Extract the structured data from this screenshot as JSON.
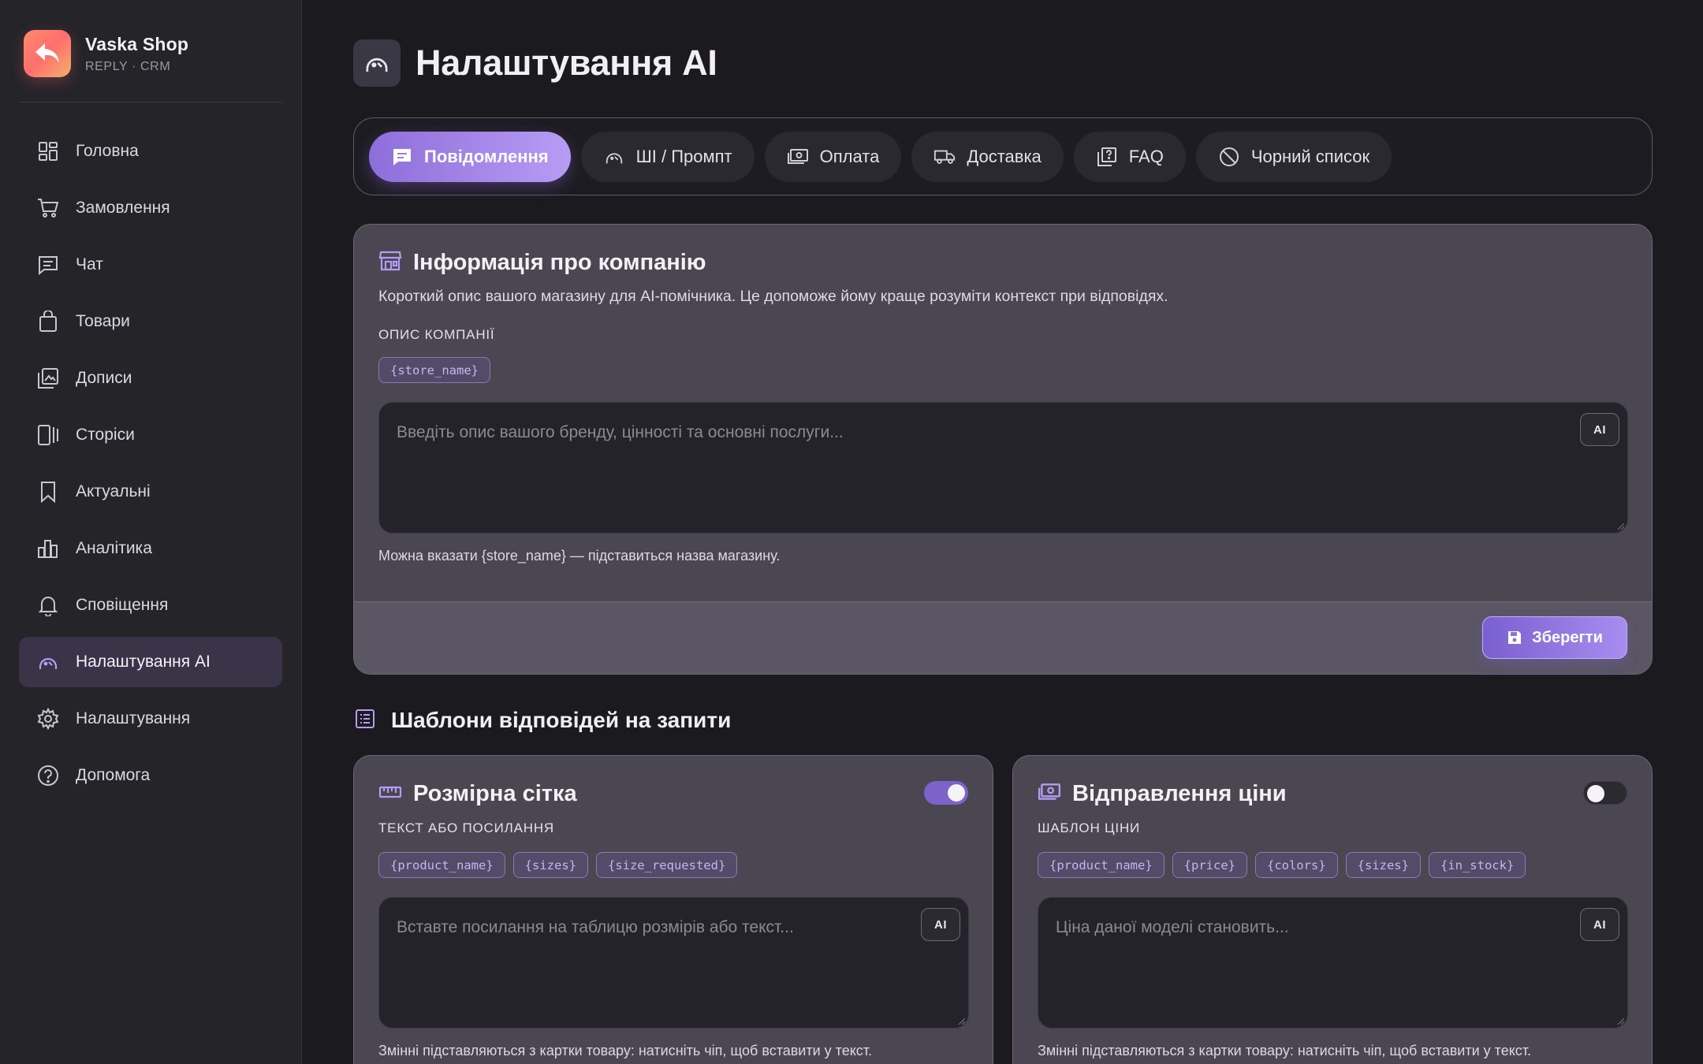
{
  "brand": {
    "name": "Vaska Shop",
    "subtitle": "REPLY · CRM"
  },
  "sidebar": {
    "items": [
      {
        "label": "Головна",
        "icon": "dashboard-icon"
      },
      {
        "label": "Замовлення",
        "icon": "cart-icon"
      },
      {
        "label": "Чат",
        "icon": "chat-icon"
      },
      {
        "label": "Товари",
        "icon": "bag-icon"
      },
      {
        "label": "Дописи",
        "icon": "image-icon"
      },
      {
        "label": "Сторіси",
        "icon": "stories-icon"
      },
      {
        "label": "Актуальні",
        "icon": "bookmark-icon"
      },
      {
        "label": "Аналітика",
        "icon": "chart-icon"
      },
      {
        "label": "Сповіщення",
        "icon": "bell-icon"
      },
      {
        "label": "Налаштування AI",
        "icon": "ai-icon",
        "active": true
      },
      {
        "label": "Налаштування",
        "icon": "gear-icon"
      },
      {
        "label": "Допомога",
        "icon": "help-icon"
      }
    ]
  },
  "page": {
    "title": "Налаштування AI"
  },
  "tabs": [
    {
      "label": "Повідомлення",
      "active": true
    },
    {
      "label": "ШІ / Промпт"
    },
    {
      "label": "Оплата"
    },
    {
      "label": "Доставка"
    },
    {
      "label": "FAQ"
    },
    {
      "label": "Чорний список"
    }
  ],
  "company": {
    "title": "Інформація про компанію",
    "description": "Короткий опис вашого магазину для AI-помічника. Це допоможе йому краще розуміти контекст при відповідях.",
    "field_label": "ОПИС КОМПАНІЇ",
    "chips": [
      "{store_name}"
    ],
    "placeholder": "Введіть опис вашого бренду, цінності та основні послуги...",
    "ai_label": "AI",
    "hint": "Можна вказати {store_name} — підставиться назва магазину.",
    "save_label": "Зберегти"
  },
  "templates": {
    "section_title": "Шаблони відповідей на запити",
    "cards": [
      {
        "title": "Розмірна сітка",
        "enabled": true,
        "field_label": "ТЕКСТ АБО ПОСИЛАННЯ",
        "chips": [
          "{product_name}",
          "{sizes}",
          "{size_requested}"
        ],
        "placeholder": "Вставте посилання на таблицю розмірів або текст...",
        "ai_label": "AI",
        "hint": "Змінні підставляються з картки товару: натисніть чіп, щоб вставити у текст."
      },
      {
        "title": "Відправлення ціни",
        "enabled": false,
        "field_label": "ШАБЛОН ЦІНИ",
        "chips": [
          "{product_name}",
          "{price}",
          "{colors}",
          "{sizes}",
          "{in_stock}"
        ],
        "placeholder": "Ціна даної моделі становить...",
        "ai_label": "AI",
        "hint": "Змінні підставляються з картки товару: натисніть чіп, щоб вставити у текст."
      }
    ]
  },
  "colors": {
    "accent": "#a88df0",
    "background": "#1b1a1f",
    "sidebar": "#252429",
    "card": "#4a4753"
  }
}
